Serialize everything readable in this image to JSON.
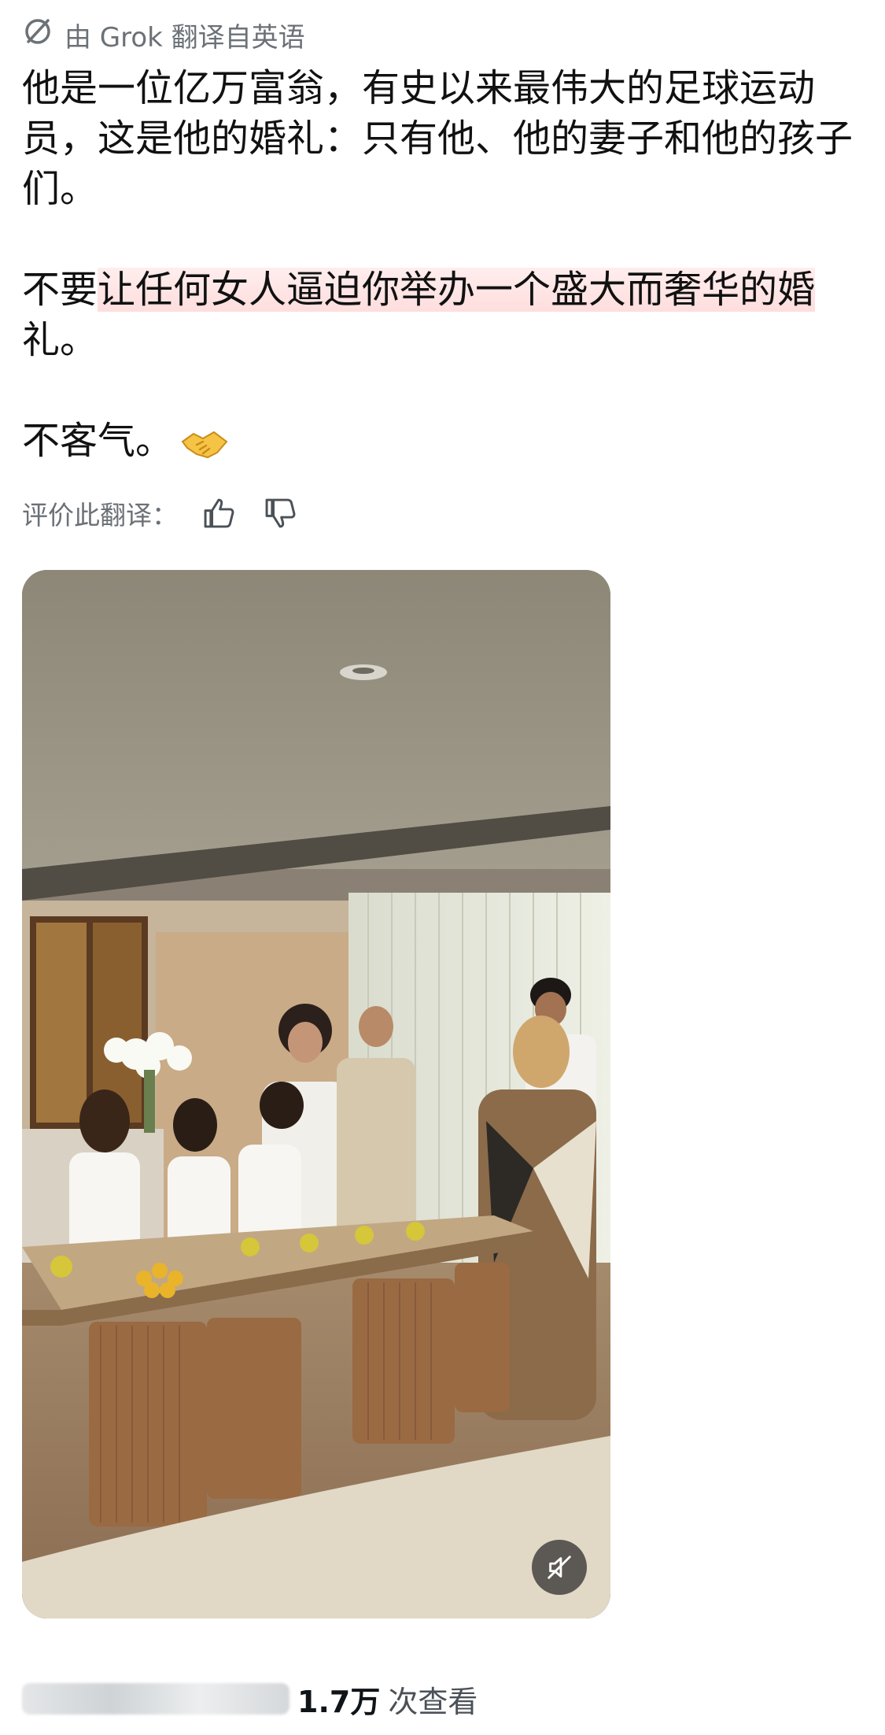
{
  "translation": {
    "label": "由 Grok 翻译自英语",
    "icon": "grok-icon"
  },
  "post": {
    "para1": "他是一位亿万富翁，有史以来最伟大的足球运动员，这是他的婚礼：只有他、他的妻子和他的孩子们。",
    "para2_pre": "不要",
    "para2_highlight": "让任何女人逼迫你举办一个盛大而奢华的婚",
    "para2_post": "礼。",
    "para3": "不客气。",
    "emoji": "handshake-icon",
    "highlight_color": "#ffd6d6"
  },
  "rating": {
    "label": "评价此翻译：",
    "up_icon": "thumbs-up-icon",
    "down_icon": "thumbs-down-icon"
  },
  "video": {
    "mute_icon": "muted-speaker-icon"
  },
  "stats": {
    "views_count": "1.7万",
    "views_label": "次查看"
  }
}
